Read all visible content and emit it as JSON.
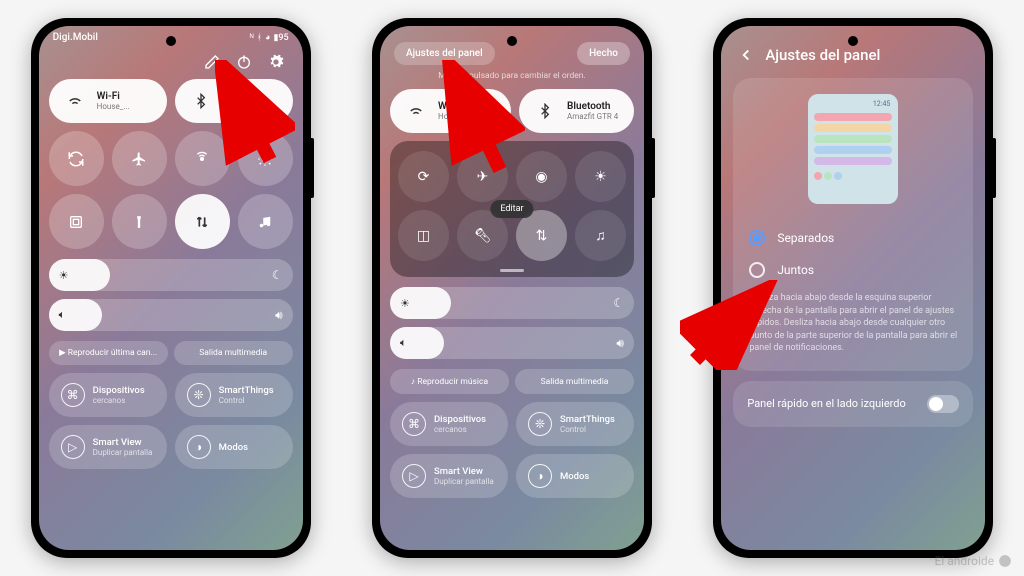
{
  "statusbar": {
    "carrier": "Digi.Mobil",
    "battery": "95"
  },
  "screen1": {
    "wifi": {
      "label": "Wi-Fi",
      "sub": "House_..."
    },
    "bt": {
      "label": "Bluetooth",
      "sub": ""
    },
    "media_chip": "▶ Reproducir última can...",
    "output_chip": "Salida multimedia",
    "devices": {
      "label": "Dispositivos",
      "sub": "cercanos"
    },
    "smartthings": {
      "label": "SmartThings",
      "sub": "Control"
    },
    "smartview": {
      "label": "Smart View",
      "sub": "Duplicar pantalla"
    },
    "modes": {
      "label": "Modos",
      "sub": ""
    }
  },
  "screen2": {
    "panel_btn": "Ajustes del panel",
    "done_btn": "Hecho",
    "hint": "Mantén pulsado para cambiar el orden.",
    "edit_pill": "Editar",
    "wifi": {
      "label": "Wi-Fi",
      "sub": "House_Of_Bars..."
    },
    "bt": {
      "label": "Bluetooth",
      "sub": "Amazfit GTR 4"
    },
    "media_chip": "♪ Reproducir música",
    "output_chip": "Salida multimedia",
    "devices": {
      "label": "Dispositivos",
      "sub": "cercanos"
    },
    "smartthings": {
      "label": "SmartThings",
      "sub": "Control"
    },
    "smartview": {
      "label": "Smart View",
      "sub": "Duplicar pantalla"
    },
    "modes": {
      "label": "Modos",
      "sub": ""
    }
  },
  "screen3": {
    "title": "Ajustes del panel",
    "preview_time": "12:45",
    "option1": "Separados",
    "option2": "Juntos",
    "help": "Desliza hacia abajo desde la esquina superior derecha de la pantalla para abrir el panel de ajustes rápidos. Desliza hacia abajo desde cualquier otro punto de la parte superior de la pantalla para abrir el panel de notificaciones.",
    "switch_label": "Panel rápido en el lado izquierdo"
  },
  "watermark": "El androide"
}
